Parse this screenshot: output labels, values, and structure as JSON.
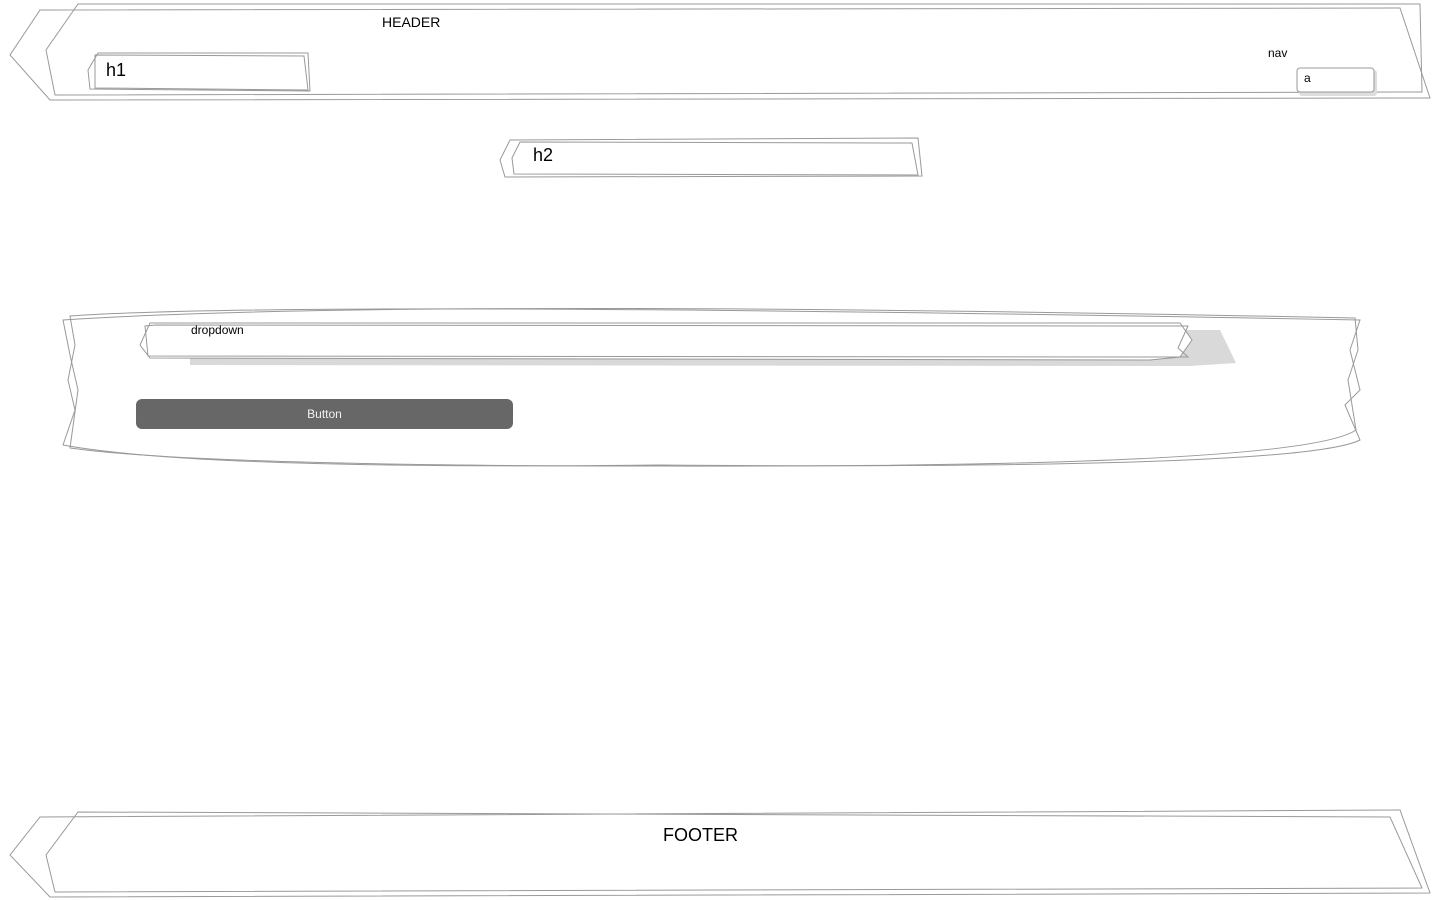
{
  "header": {
    "label": "HEADER",
    "h1": "h1",
    "nav_label": "nav",
    "nav_link": "a"
  },
  "main": {
    "h2": "h2",
    "dropdown_label": "dropdown",
    "button_label": "Button"
  },
  "footer": {
    "label": "FOOTER"
  },
  "colors": {
    "stroke": "#999999",
    "button": "#676767",
    "shadow": "#d9d9d9"
  }
}
